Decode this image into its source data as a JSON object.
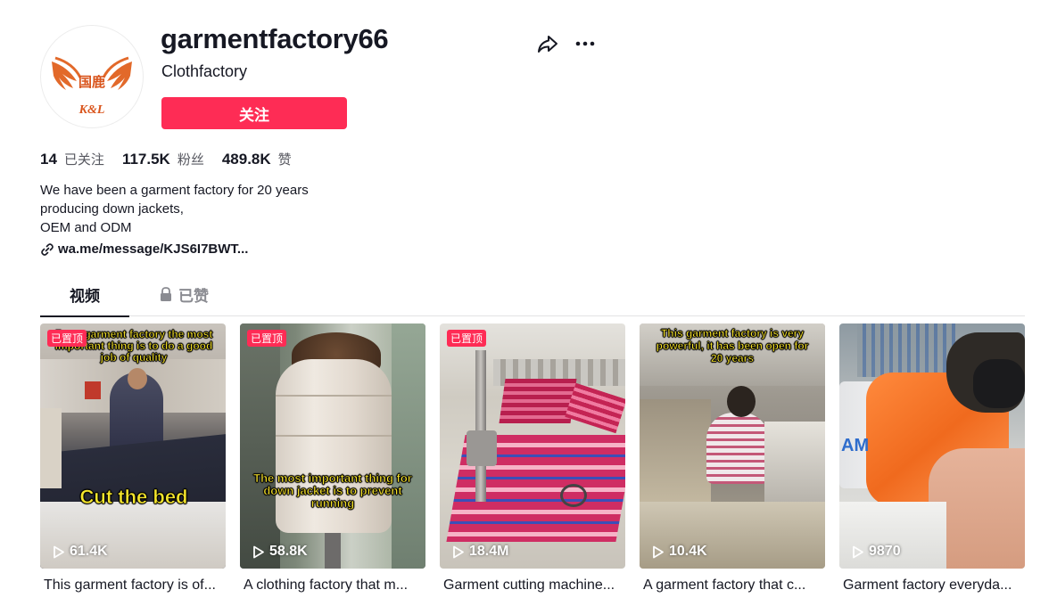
{
  "profile": {
    "username": "garmentfactory66",
    "nickname": "Clothfactory",
    "avatar_text_top": "国鹿",
    "avatar_text_bottom": "K&L",
    "follow_label": "关注"
  },
  "stats": {
    "following_count": "14",
    "following_label": "已关注",
    "followers_count": "117.5K",
    "followers_label": "粉丝",
    "likes_count": "489.8K",
    "likes_label": "赞"
  },
  "bio": {
    "line1": "We have been a garment factory for 20 years",
    "line2": "producing down jackets,",
    "line3": "OEM and ODM",
    "link": "wa.me/message/KJS6I7BWT..."
  },
  "tabs": {
    "videos": "视频",
    "liked": "已赞"
  },
  "videos": [
    {
      "pinned": "已置顶",
      "views": "61.4K",
      "caption": "This garment factory is of...",
      "overlay_top": "For a garment factory the most important thing is to do a good job of quality",
      "overlay_main": "Cut the bed"
    },
    {
      "pinned": "已置顶",
      "views": "58.8K",
      "caption": "A clothing factory that m...",
      "overlay_main": "The most important thing for down jacket is to prevent running"
    },
    {
      "pinned": "已置顶",
      "views": "18.4M",
      "caption": "Garment cutting machine..."
    },
    {
      "views": "10.4K",
      "caption": "A garment factory that c...",
      "overlay_top": "This garment factory is very powerful, it has been open for 20 years"
    },
    {
      "views": "9870",
      "caption": "Garment factory everyda...",
      "machine_text": "AM"
    }
  ],
  "colors": {
    "accent": "#fe2c55",
    "text": "#161823",
    "secondary": "#56575f",
    "overlay": "#f7e32a"
  },
  "icons": [
    "share-icon",
    "more-icon",
    "link-icon",
    "lock-icon",
    "play-icon"
  ]
}
